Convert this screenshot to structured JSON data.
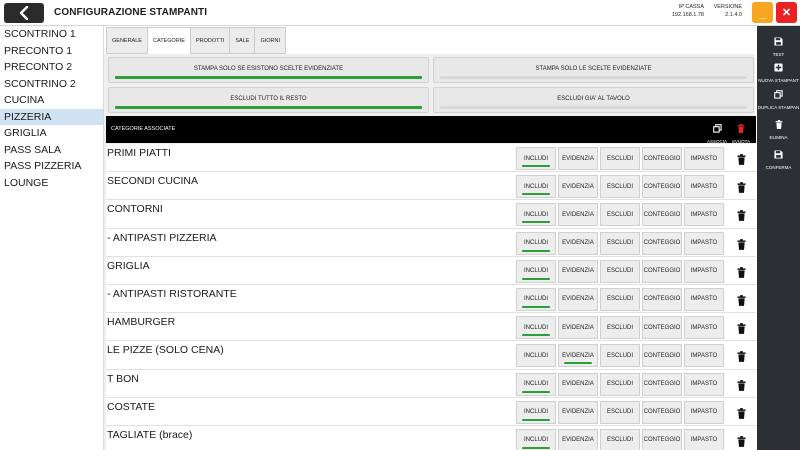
{
  "header": {
    "title": "CONFIGURAZIONE STAMPANTI",
    "ip_label": "IP CASSA",
    "ip_value": "192.168.1.78",
    "version_label": "VERSIONE",
    "version_value": "2.1.4.0",
    "minimize_label": "_",
    "close_label": "✕"
  },
  "printers": [
    {
      "label": "SCONTRINO 1"
    },
    {
      "label": "PRECONTO 1"
    },
    {
      "label": "PRECONTO 2"
    },
    {
      "label": "SCONTRINO 2"
    },
    {
      "label": "CUCINA"
    },
    {
      "label": "PIZZERIA",
      "selected": true
    },
    {
      "label": "GRIGLIA"
    },
    {
      "label": "PASS SALA"
    },
    {
      "label": "PASS PIZZERIA"
    },
    {
      "label": "LOUNGE"
    }
  ],
  "tabs": [
    {
      "label": "GENERALE"
    },
    {
      "label": "CATEGORIE",
      "active": true
    },
    {
      "label": "PRODOTTI"
    },
    {
      "label": "SALE"
    },
    {
      "label": "GIORNI"
    }
  ],
  "options": [
    {
      "label": "STAMPA SOLO SE ESISTONO SCELTE EVIDENZIATE",
      "on": true
    },
    {
      "label": "STAMPA SOLO LE SCELTE EVIDENZIATE",
      "on": false
    },
    {
      "label": "ESCLUDI TUTTO IL RESTO",
      "on": true
    },
    {
      "label": "ESCLUDI GIA' AL TAVOLO",
      "on": false
    }
  ],
  "categories_header": {
    "title": "CATEGORIE ASSOCIATE",
    "associa_label": "ASSOCIA",
    "svuota_label": "SVUOTA"
  },
  "segment_labels": [
    "INCLUDI",
    "EVIDENZIA",
    "ESCLUDI",
    "CONTEGGIO",
    "IMPASTO"
  ],
  "categories": [
    {
      "name": "PRIMI PIATTI",
      "selected": "INCLUDI"
    },
    {
      "name": "SECONDI CUCINA",
      "selected": "INCLUDI"
    },
    {
      "name": "CONTORNI",
      "selected": "INCLUDI"
    },
    {
      "name": "- ANTIPASTI PIZZERIA",
      "selected": "INCLUDI"
    },
    {
      "name": "GRIGLIA",
      "selected": "INCLUDI"
    },
    {
      "name": "- ANTIPASTI RISTORANTE",
      "selected": "INCLUDI"
    },
    {
      "name": "HAMBURGER",
      "selected": "INCLUDI"
    },
    {
      "name": "LE PIZZE (SOLO CENA)",
      "selected": "EVIDENZIA"
    },
    {
      "name": "T BON",
      "selected": "INCLUDI"
    },
    {
      "name": "COSTATE",
      "selected": "INCLUDI"
    },
    {
      "name": "TAGLIATE (brace)",
      "selected": "INCLUDI"
    }
  ],
  "toolbar": [
    {
      "label": "TEST",
      "icon": "save-icon"
    },
    {
      "label": "NUOVA STAMPANT",
      "icon": "add-icon"
    },
    {
      "label": "DUPLICA STAMPAN",
      "icon": "copy-icon"
    },
    {
      "label": "ELIMINA",
      "icon": "trash-icon"
    },
    {
      "label": "CONFERMA",
      "icon": "save-icon"
    }
  ],
  "colors": {
    "accent_green": "#2e9e3c",
    "selected_row": "#cfe3f5",
    "minimize_orange": "#f5a623",
    "close_red": "#e82323",
    "toolbar_dark": "#2b2f36",
    "trash_red": "#e82323"
  }
}
